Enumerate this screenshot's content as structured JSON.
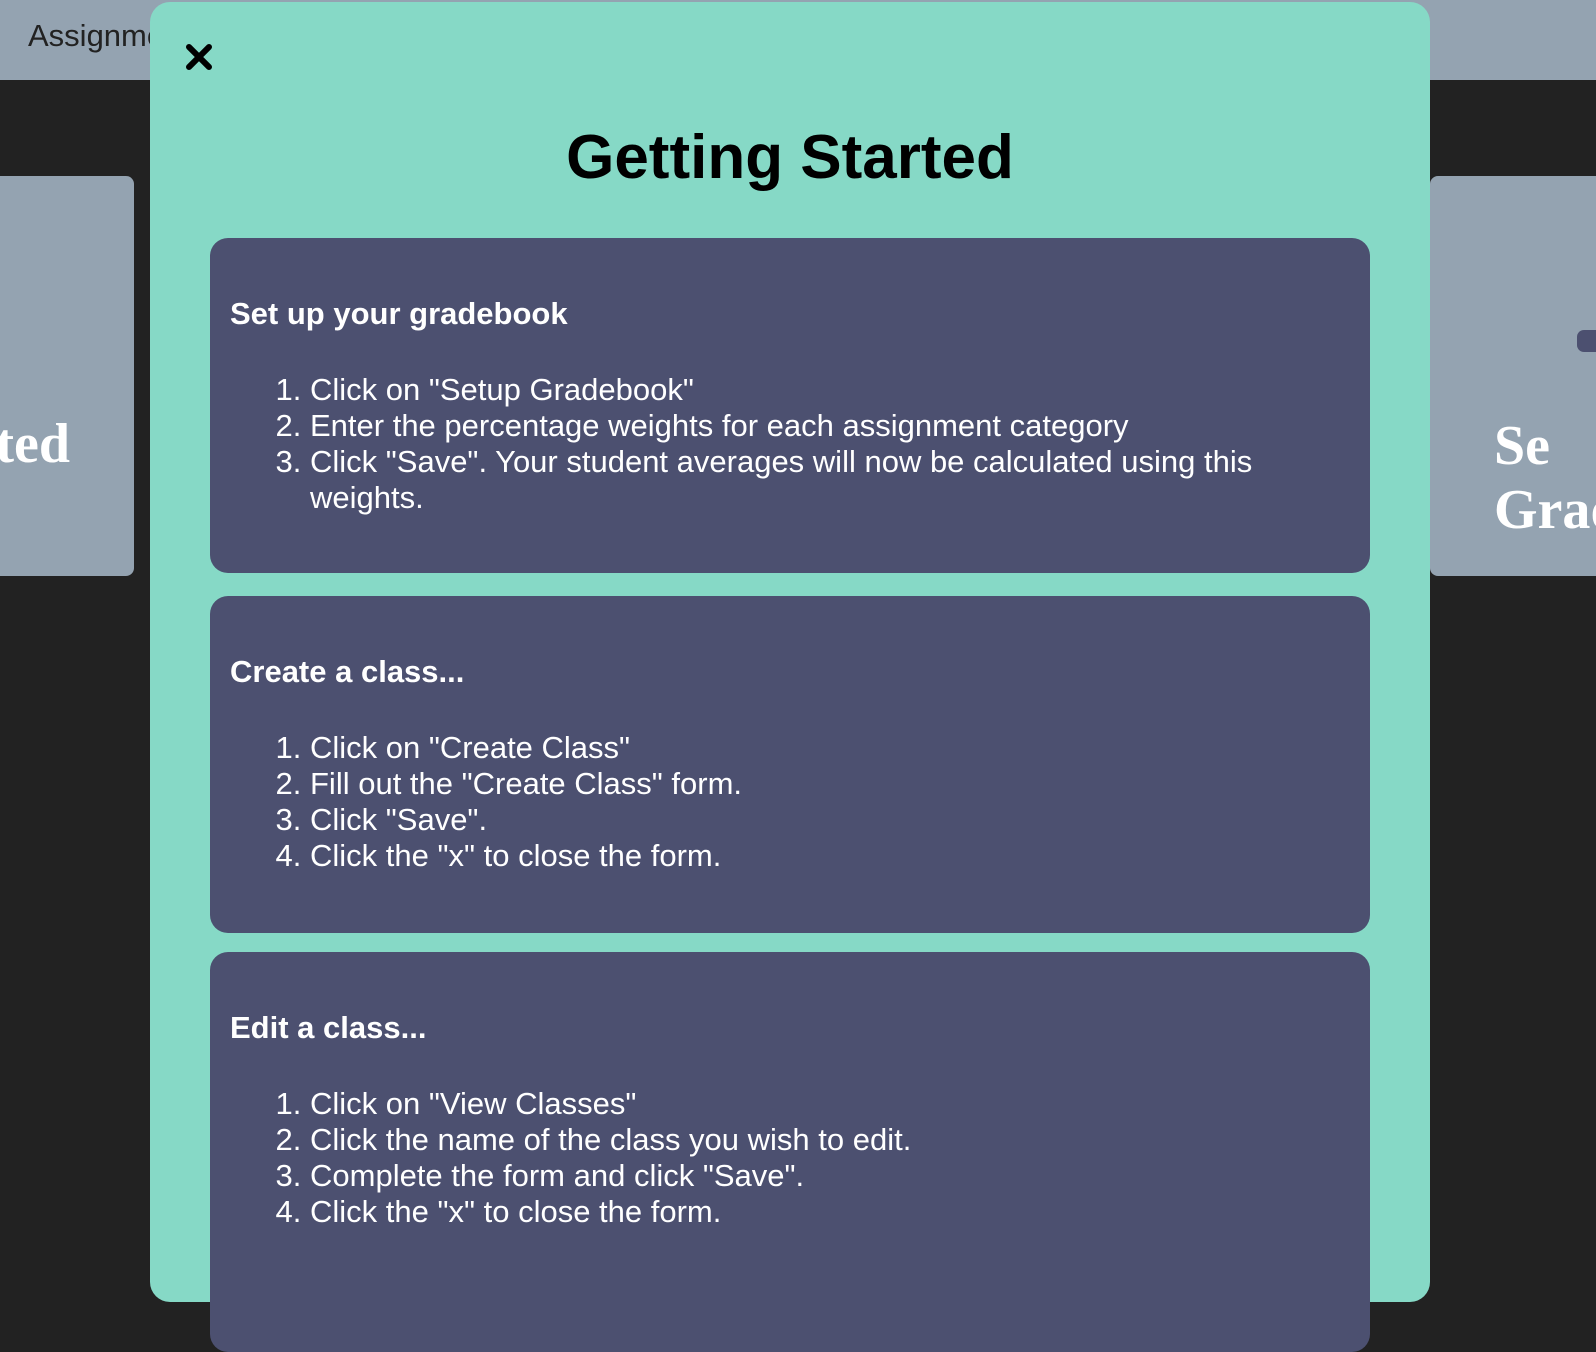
{
  "topbar": {
    "label": "Assignments"
  },
  "background_cards": [
    {
      "title": "Getting Started"
    },
    {
      "title": "Setup Gradebook"
    }
  ],
  "modal": {
    "close_icon": "close-icon",
    "title": "Getting Started",
    "sections": [
      {
        "heading": "Set up your gradebook",
        "steps": [
          "Click on \"Setup Gradebook\"",
          "Enter the percentage weights for each assignment category",
          "Click \"Save\". Your student averages will now be calculated using this weights."
        ]
      },
      {
        "heading": "Create a class...",
        "steps": [
          "Click on \"Create Class\"",
          "Fill out the \"Create Class\" form.",
          "Click \"Save\".",
          "Click the \"x\" to close the form."
        ]
      },
      {
        "heading": "Edit a class...",
        "steps": [
          "Click on \"View Classes\"",
          "Click the name of the class you wish to edit.",
          "Complete the form and click \"Save\".",
          "Click the \"x\" to close the form."
        ]
      }
    ]
  }
}
